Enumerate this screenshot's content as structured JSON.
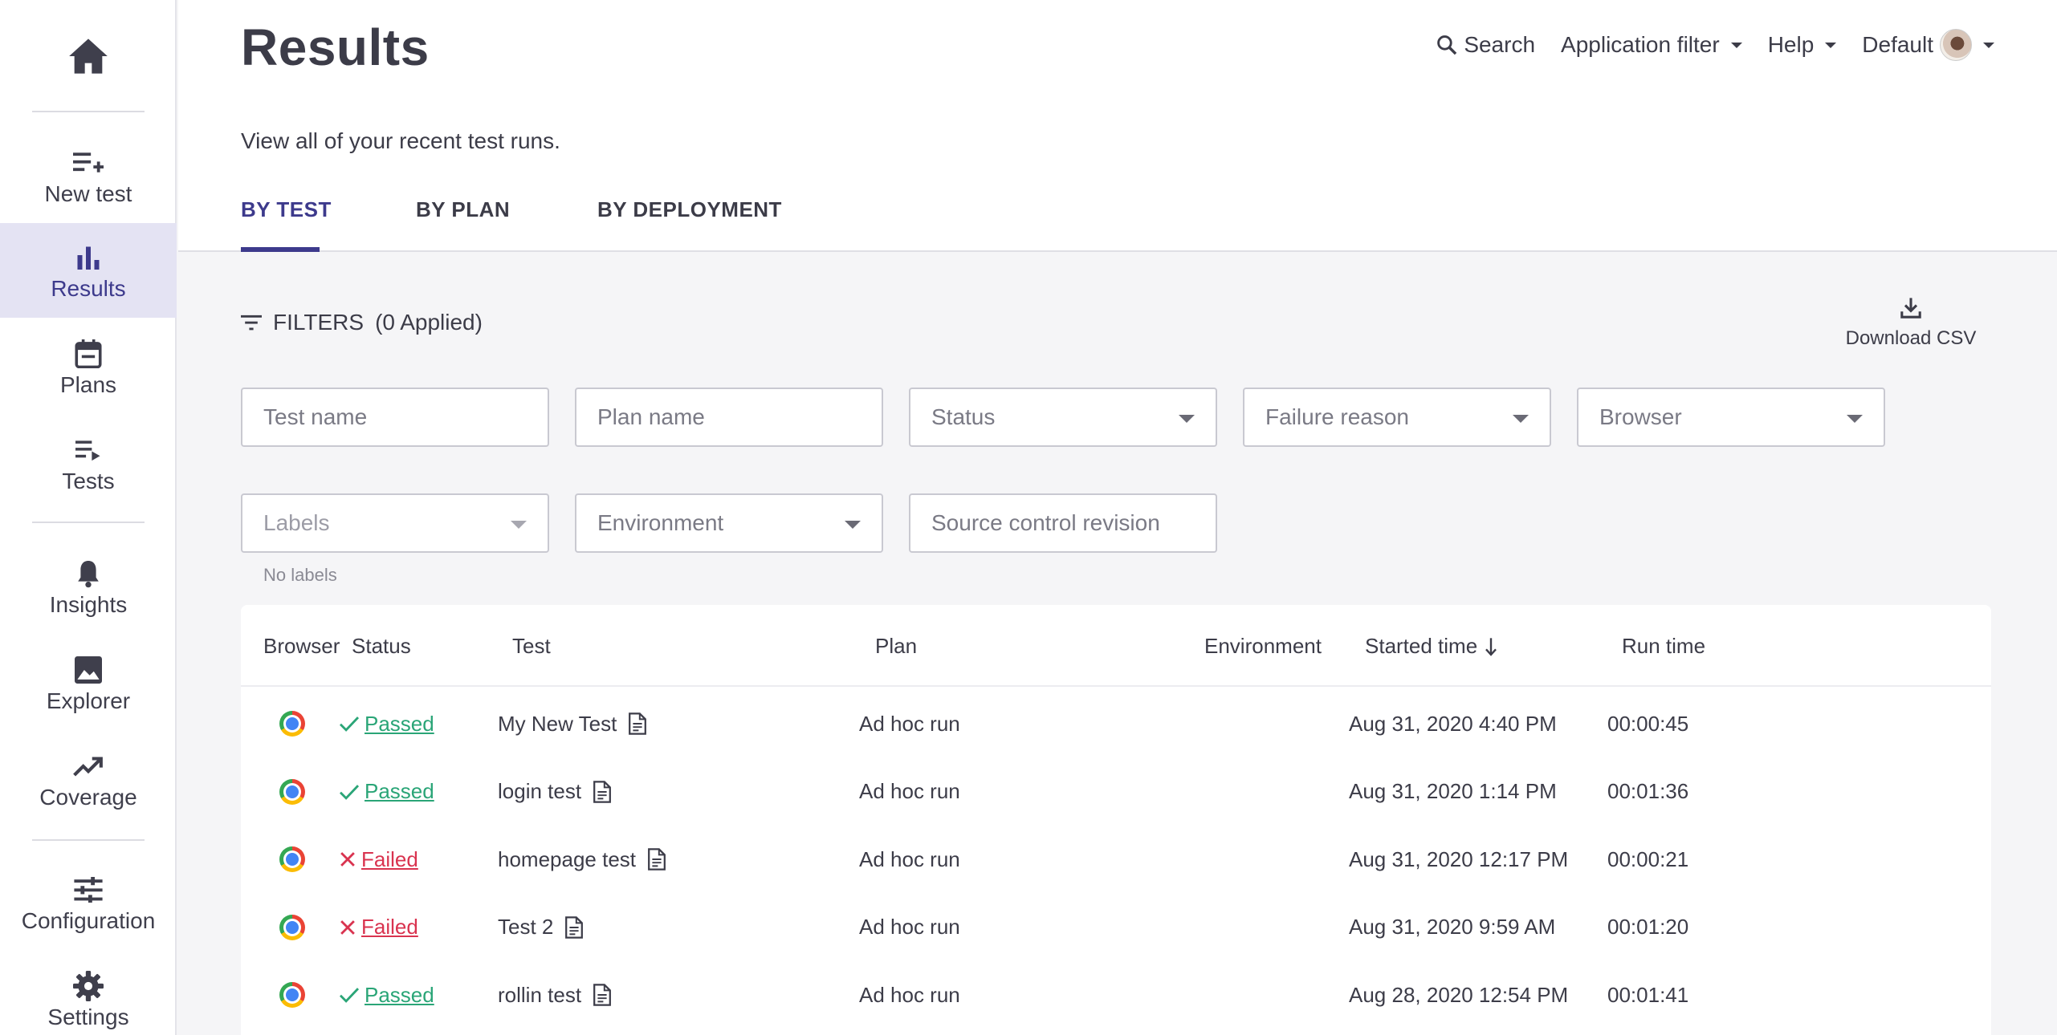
{
  "sidebar": {
    "items": [
      {
        "label": "New test",
        "icon": "playlist-add-icon"
      },
      {
        "label": "Results",
        "icon": "bar-chart-icon",
        "active": true
      },
      {
        "label": "Plans",
        "icon": "calendar-icon"
      },
      {
        "label": "Tests",
        "icon": "playlist-play-icon"
      },
      {
        "label": "Insights",
        "icon": "bell-icon"
      },
      {
        "label": "Explorer",
        "icon": "image-icon"
      },
      {
        "label": "Coverage",
        "icon": "trending-up-icon"
      },
      {
        "label": "Configuration",
        "icon": "sliders-icon"
      },
      {
        "label": "Settings",
        "icon": "gear-icon"
      }
    ]
  },
  "header": {
    "title": "Results",
    "subtitle": "View all of your recent test runs.",
    "tabs": [
      {
        "label": "BY TEST",
        "active": true
      },
      {
        "label": "BY PLAN"
      },
      {
        "label": "BY DEPLOYMENT"
      }
    ],
    "nav": {
      "search": "Search",
      "app_filter": "Application filter",
      "help": "Help",
      "account": "Default"
    }
  },
  "filters": {
    "label": "FILTERS",
    "applied": "(0 Applied)",
    "download_label": "Download CSV",
    "test_name_placeholder": "Test name",
    "plan_name_placeholder": "Plan name",
    "status": "Status",
    "failure_reason": "Failure reason",
    "browser": "Browser",
    "labels": "Labels",
    "environment": "Environment",
    "source_control_placeholder": "Source control revision",
    "labels_helper": "No labels"
  },
  "table": {
    "columns": {
      "browser": "Browser",
      "status": "Status",
      "test": "Test",
      "plan": "Plan",
      "environment": "Environment",
      "started": "Started time",
      "runtime": "Run time"
    },
    "rows": [
      {
        "browser": "chrome-icon",
        "status": "Passed",
        "test": "My New Test",
        "plan": "Ad hoc run",
        "environment": "",
        "started": "Aug 31, 2020 4:40 PM",
        "runtime": "00:00:45"
      },
      {
        "browser": "chrome-icon",
        "status": "Passed",
        "test": "login test",
        "plan": "Ad hoc run",
        "environment": "",
        "started": "Aug 31, 2020 1:14 PM",
        "runtime": "00:01:36"
      },
      {
        "browser": "chrome-icon",
        "status": "Failed",
        "test": "homepage test",
        "plan": "Ad hoc run",
        "environment": "",
        "started": "Aug 31, 2020 12:17 PM",
        "runtime": "00:00:21"
      },
      {
        "browser": "chrome-icon",
        "status": "Failed",
        "test": "Test 2",
        "plan": "Ad hoc run",
        "environment": "",
        "started": "Aug 31, 2020 9:59 AM",
        "runtime": "00:01:20"
      },
      {
        "browser": "chrome-icon",
        "status": "Passed",
        "test": "rollin test",
        "plan": "Ad hoc run",
        "environment": "",
        "started": "Aug 28, 2020 12:54 PM",
        "runtime": "00:01:41"
      }
    ]
  },
  "colors": {
    "accent": "#3d3a8c",
    "passed": "#2aa577",
    "failed": "#d9334f",
    "active_nav_bg": "#e4e3f3"
  }
}
